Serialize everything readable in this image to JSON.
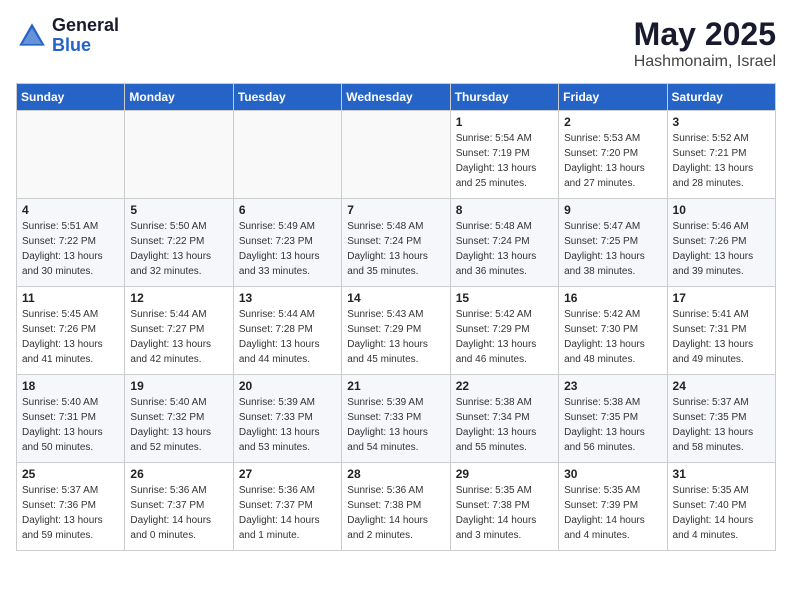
{
  "logo": {
    "general": "General",
    "blue": "Blue"
  },
  "title": {
    "month": "May 2025",
    "location": "Hashmonaim, Israel"
  },
  "header_days": [
    "Sunday",
    "Monday",
    "Tuesday",
    "Wednesday",
    "Thursday",
    "Friday",
    "Saturday"
  ],
  "weeks": [
    [
      {
        "day": "",
        "info": ""
      },
      {
        "day": "",
        "info": ""
      },
      {
        "day": "",
        "info": ""
      },
      {
        "day": "",
        "info": ""
      },
      {
        "day": "1",
        "info": "Sunrise: 5:54 AM\nSunset: 7:19 PM\nDaylight: 13 hours\nand 25 minutes."
      },
      {
        "day": "2",
        "info": "Sunrise: 5:53 AM\nSunset: 7:20 PM\nDaylight: 13 hours\nand 27 minutes."
      },
      {
        "day": "3",
        "info": "Sunrise: 5:52 AM\nSunset: 7:21 PM\nDaylight: 13 hours\nand 28 minutes."
      }
    ],
    [
      {
        "day": "4",
        "info": "Sunrise: 5:51 AM\nSunset: 7:22 PM\nDaylight: 13 hours\nand 30 minutes."
      },
      {
        "day": "5",
        "info": "Sunrise: 5:50 AM\nSunset: 7:22 PM\nDaylight: 13 hours\nand 32 minutes."
      },
      {
        "day": "6",
        "info": "Sunrise: 5:49 AM\nSunset: 7:23 PM\nDaylight: 13 hours\nand 33 minutes."
      },
      {
        "day": "7",
        "info": "Sunrise: 5:48 AM\nSunset: 7:24 PM\nDaylight: 13 hours\nand 35 minutes."
      },
      {
        "day": "8",
        "info": "Sunrise: 5:48 AM\nSunset: 7:24 PM\nDaylight: 13 hours\nand 36 minutes."
      },
      {
        "day": "9",
        "info": "Sunrise: 5:47 AM\nSunset: 7:25 PM\nDaylight: 13 hours\nand 38 minutes."
      },
      {
        "day": "10",
        "info": "Sunrise: 5:46 AM\nSunset: 7:26 PM\nDaylight: 13 hours\nand 39 minutes."
      }
    ],
    [
      {
        "day": "11",
        "info": "Sunrise: 5:45 AM\nSunset: 7:26 PM\nDaylight: 13 hours\nand 41 minutes."
      },
      {
        "day": "12",
        "info": "Sunrise: 5:44 AM\nSunset: 7:27 PM\nDaylight: 13 hours\nand 42 minutes."
      },
      {
        "day": "13",
        "info": "Sunrise: 5:44 AM\nSunset: 7:28 PM\nDaylight: 13 hours\nand 44 minutes."
      },
      {
        "day": "14",
        "info": "Sunrise: 5:43 AM\nSunset: 7:29 PM\nDaylight: 13 hours\nand 45 minutes."
      },
      {
        "day": "15",
        "info": "Sunrise: 5:42 AM\nSunset: 7:29 PM\nDaylight: 13 hours\nand 46 minutes."
      },
      {
        "day": "16",
        "info": "Sunrise: 5:42 AM\nSunset: 7:30 PM\nDaylight: 13 hours\nand 48 minutes."
      },
      {
        "day": "17",
        "info": "Sunrise: 5:41 AM\nSunset: 7:31 PM\nDaylight: 13 hours\nand 49 minutes."
      }
    ],
    [
      {
        "day": "18",
        "info": "Sunrise: 5:40 AM\nSunset: 7:31 PM\nDaylight: 13 hours\nand 50 minutes."
      },
      {
        "day": "19",
        "info": "Sunrise: 5:40 AM\nSunset: 7:32 PM\nDaylight: 13 hours\nand 52 minutes."
      },
      {
        "day": "20",
        "info": "Sunrise: 5:39 AM\nSunset: 7:33 PM\nDaylight: 13 hours\nand 53 minutes."
      },
      {
        "day": "21",
        "info": "Sunrise: 5:39 AM\nSunset: 7:33 PM\nDaylight: 13 hours\nand 54 minutes."
      },
      {
        "day": "22",
        "info": "Sunrise: 5:38 AM\nSunset: 7:34 PM\nDaylight: 13 hours\nand 55 minutes."
      },
      {
        "day": "23",
        "info": "Sunrise: 5:38 AM\nSunset: 7:35 PM\nDaylight: 13 hours\nand 56 minutes."
      },
      {
        "day": "24",
        "info": "Sunrise: 5:37 AM\nSunset: 7:35 PM\nDaylight: 13 hours\nand 58 minutes."
      }
    ],
    [
      {
        "day": "25",
        "info": "Sunrise: 5:37 AM\nSunset: 7:36 PM\nDaylight: 13 hours\nand 59 minutes."
      },
      {
        "day": "26",
        "info": "Sunrise: 5:36 AM\nSunset: 7:37 PM\nDaylight: 14 hours\nand 0 minutes."
      },
      {
        "day": "27",
        "info": "Sunrise: 5:36 AM\nSunset: 7:37 PM\nDaylight: 14 hours\nand 1 minute."
      },
      {
        "day": "28",
        "info": "Sunrise: 5:36 AM\nSunset: 7:38 PM\nDaylight: 14 hours\nand 2 minutes."
      },
      {
        "day": "29",
        "info": "Sunrise: 5:35 AM\nSunset: 7:38 PM\nDaylight: 14 hours\nand 3 minutes."
      },
      {
        "day": "30",
        "info": "Sunrise: 5:35 AM\nSunset: 7:39 PM\nDaylight: 14 hours\nand 4 minutes."
      },
      {
        "day": "31",
        "info": "Sunrise: 5:35 AM\nSunset: 7:40 PM\nDaylight: 14 hours\nand 4 minutes."
      }
    ]
  ]
}
